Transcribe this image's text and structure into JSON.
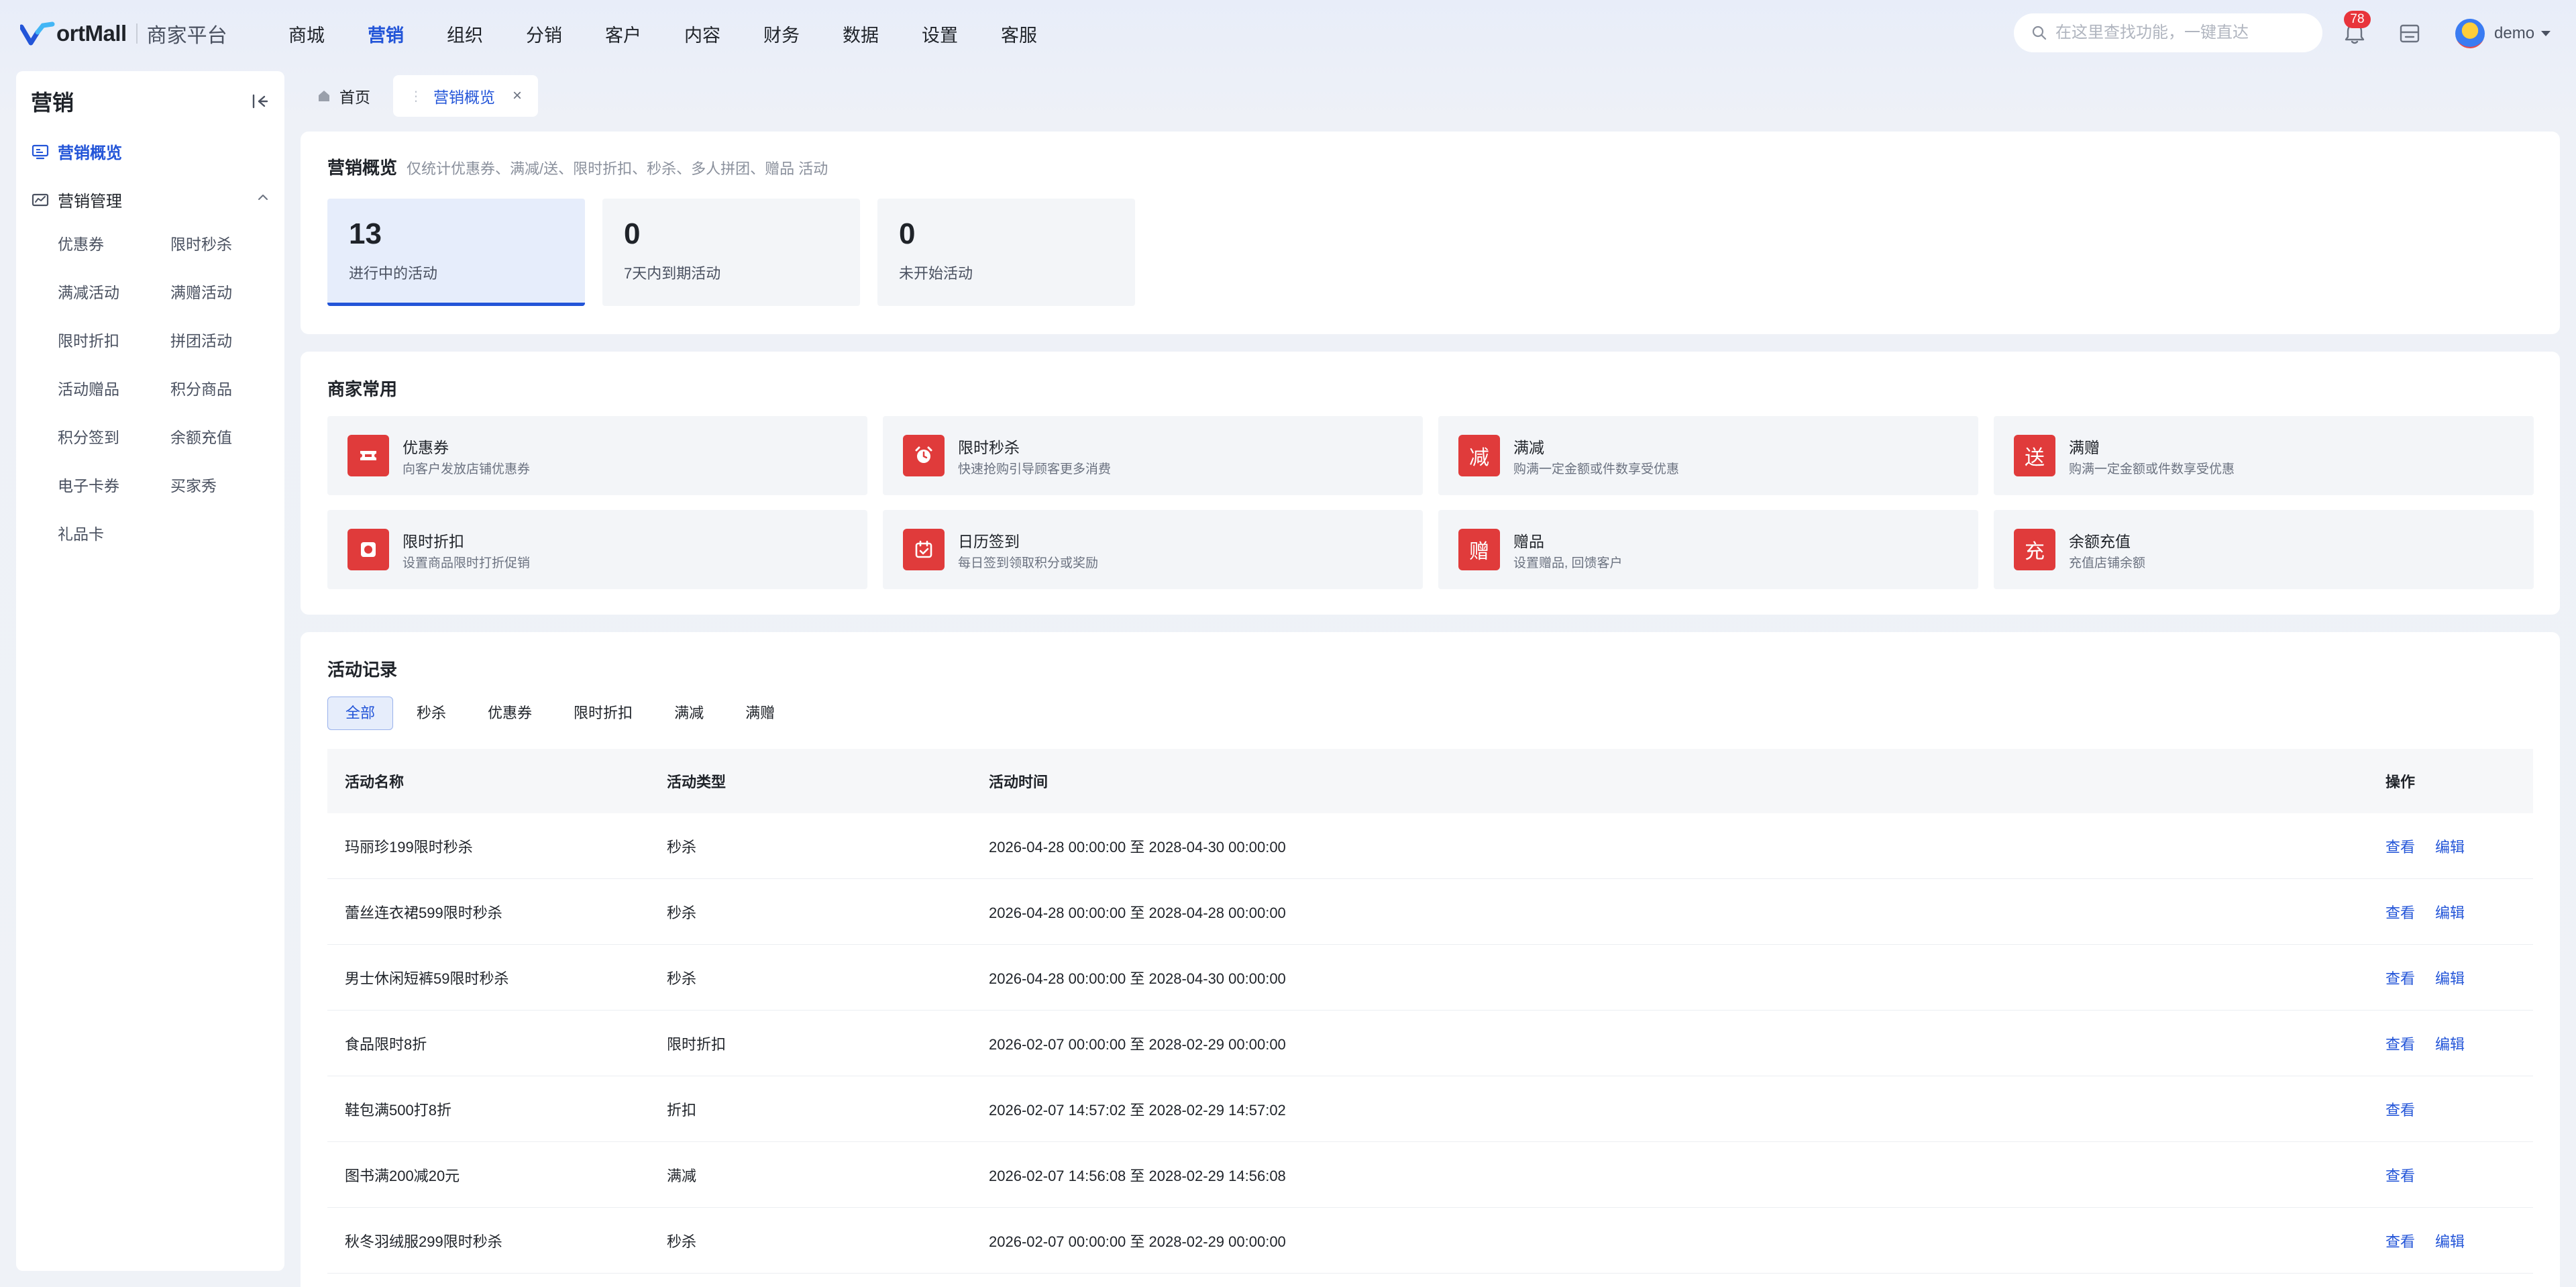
{
  "brand": {
    "name": "ortMall",
    "sub": "商家平台"
  },
  "nav": {
    "items": [
      "商城",
      "营销",
      "组织",
      "分销",
      "客户",
      "内容",
      "财务",
      "数据",
      "设置",
      "客服"
    ],
    "active_index": 1
  },
  "header": {
    "search_placeholder": "在这里查找功能，一键直达",
    "notifications": "78",
    "user": "demo"
  },
  "sidebar": {
    "title": "营销",
    "overview": "营销概览",
    "group": "营销管理",
    "links": [
      "优惠券",
      "限时秒杀",
      "满减活动",
      "满赠活动",
      "限时折扣",
      "拼团活动",
      "活动赠品",
      "积分商品",
      "积分签到",
      "余额充值",
      "电子卡券",
      "买家秀",
      "礼品卡"
    ]
  },
  "tabs": [
    {
      "label": "首页",
      "icon": "home-icon"
    },
    {
      "label": "营销概览",
      "active": true
    }
  ],
  "overview": {
    "title": "营销概览",
    "subtitle": "仅统计优惠券、满减/送、限时折扣、秒杀、多人拼团、赠品 活动",
    "stats": [
      {
        "value": "13",
        "label": "进行中的活动",
        "active": true
      },
      {
        "value": "0",
        "label": "7天内到期活动"
      },
      {
        "value": "0",
        "label": "未开始活动"
      }
    ]
  },
  "common": {
    "title": "商家常用",
    "items": [
      {
        "name": "优惠券",
        "desc": "向客户发放店铺优惠券",
        "icon": "ticket-icon",
        "glyph": ""
      },
      {
        "name": "限时秒杀",
        "desc": "快速抢购引导顾客更多消费",
        "icon": "alarm-clock-icon",
        "glyph": ""
      },
      {
        "name": "满减",
        "desc": "购满一定金额或件数享受优惠",
        "icon": "discount-icon",
        "glyph": "减"
      },
      {
        "name": "满赠",
        "desc": "购满一定金额或件数享受优惠",
        "icon": "gift-send-icon",
        "glyph": "送"
      },
      {
        "name": "限时折扣",
        "desc": "设置商品限时打折促销",
        "icon": "timer-icon",
        "glyph": ""
      },
      {
        "name": "日历签到",
        "desc": "每日签到领取积分或奖励",
        "icon": "calendar-check-icon",
        "glyph": ""
      },
      {
        "name": "赠品",
        "desc": "设置赠品, 回馈客户",
        "icon": "gift-icon",
        "glyph": "赠"
      },
      {
        "name": "余额充值",
        "desc": "充值店铺余额",
        "icon": "recharge-icon",
        "glyph": "充"
      }
    ]
  },
  "records": {
    "title": "活动记录",
    "filters": [
      "全部",
      "秒杀",
      "优惠券",
      "限时折扣",
      "满减",
      "满赠"
    ],
    "active_filter": 0,
    "columns": [
      "活动名称",
      "活动类型",
      "活动时间",
      "操作"
    ],
    "rows": [
      {
        "name": "玛丽珍199限时秒杀",
        "type": "秒杀",
        "time": "2026-04-28 00:00:00 至 2028-04-30 00:00:00",
        "actions": [
          "查看",
          "编辑"
        ]
      },
      {
        "name": "蕾丝连衣裙599限时秒杀",
        "type": "秒杀",
        "time": "2026-04-28 00:00:00 至 2028-04-28 00:00:00",
        "actions": [
          "查看",
          "编辑"
        ]
      },
      {
        "name": "男士休闲短裤59限时秒杀",
        "type": "秒杀",
        "time": "2026-04-28 00:00:00 至 2028-04-30 00:00:00",
        "actions": [
          "查看",
          "编辑"
        ]
      },
      {
        "name": "食品限时8折",
        "type": "限时折扣",
        "time": "2026-02-07 00:00:00 至 2028-02-29 00:00:00",
        "actions": [
          "查看",
          "编辑"
        ]
      },
      {
        "name": "鞋包满500打8折",
        "type": "折扣",
        "time": "2026-02-07 14:57:02 至 2028-02-29 14:57:02",
        "actions": [
          "查看"
        ]
      },
      {
        "name": "图书满200减20元",
        "type": "满减",
        "time": "2026-02-07 14:56:08 至 2028-02-29 14:56:08",
        "actions": [
          "查看"
        ]
      },
      {
        "name": "秋冬羽绒服299限时秒杀",
        "type": "秒杀",
        "time": "2026-02-07 00:00:00 至 2028-02-29 00:00:00",
        "actions": [
          "查看",
          "编辑"
        ]
      }
    ]
  },
  "colors": {
    "accent": "#2355d8",
    "icon_red": "#e03b3b",
    "badge": "#e8343b"
  }
}
